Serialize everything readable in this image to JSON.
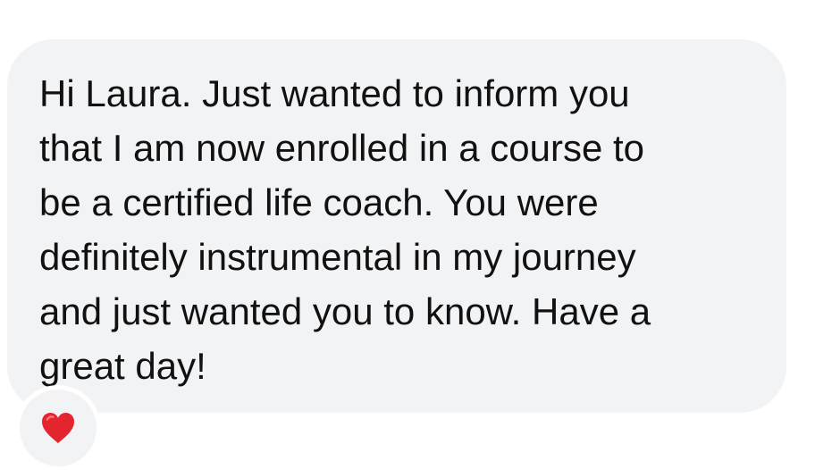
{
  "message": {
    "text": "Hi Laura. Just wanted to inform you\nthat I am now enrolled in a course to\nbe a certified life coach. You were\ndefinitely instrumental in my journey\nand just wanted you to know. Have a\ngreat day!"
  },
  "reaction": {
    "icon": "heart-icon",
    "color": "#e5252d"
  },
  "colors": {
    "bubble": "#f2f3f5",
    "text": "#111111",
    "background": "#ffffff"
  }
}
